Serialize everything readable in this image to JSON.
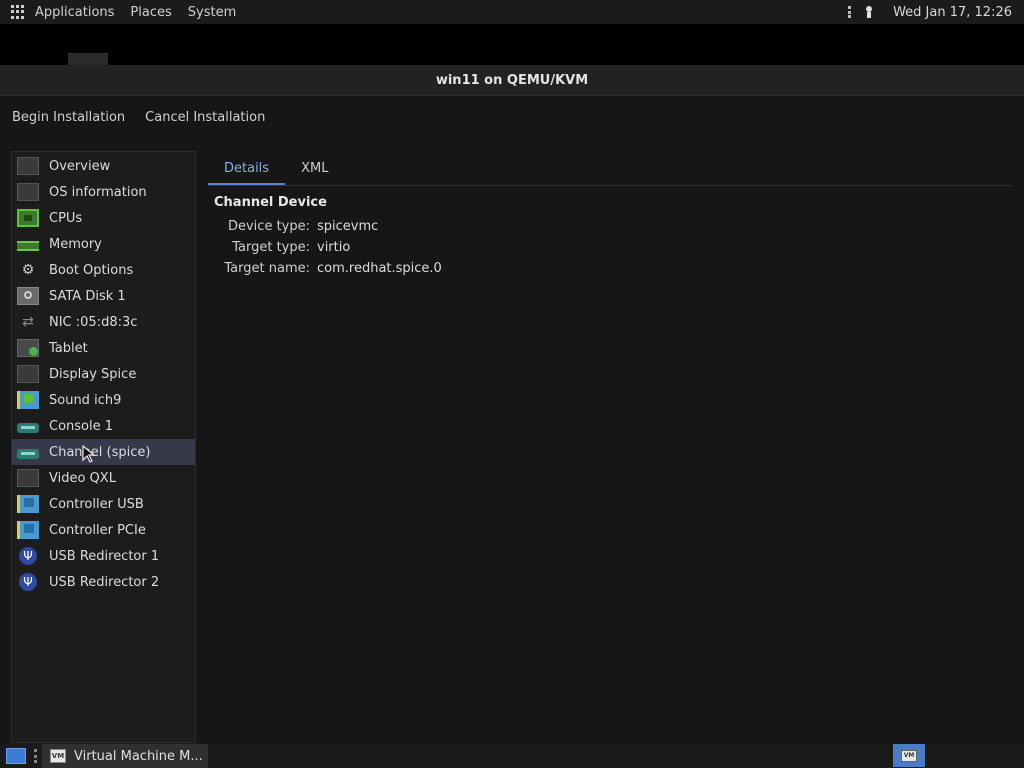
{
  "top_panel": {
    "menus": [
      "Applications",
      "Places",
      "System"
    ],
    "clock": "Wed Jan 17, 12:26"
  },
  "window": {
    "title": "win11 on QEMU/KVM",
    "toolbar": {
      "begin_label": "Begin Installation",
      "cancel_label": "Cancel Installation"
    },
    "sidebar": {
      "items": [
        {
          "label": "Overview",
          "icon": "monitor-icon"
        },
        {
          "label": "OS information",
          "icon": "monitor-icon"
        },
        {
          "label": "CPUs",
          "icon": "cpu-icon"
        },
        {
          "label": "Memory",
          "icon": "memory-icon"
        },
        {
          "label": "Boot Options",
          "icon": "gear-icon"
        },
        {
          "label": "SATA Disk 1",
          "icon": "disk-icon"
        },
        {
          "label": "NIC :05:d8:3c",
          "icon": "network-icon"
        },
        {
          "label": "Tablet",
          "icon": "tablet-icon"
        },
        {
          "label": "Display Spice",
          "icon": "monitor-icon"
        },
        {
          "label": "Sound ich9",
          "icon": "sound-card-icon"
        },
        {
          "label": "Console 1",
          "icon": "serial-icon"
        },
        {
          "label": "Channel (spice)",
          "icon": "serial-icon",
          "selected": true
        },
        {
          "label": "Video QXL",
          "icon": "monitor-icon"
        },
        {
          "label": "Controller USB",
          "icon": "controller-card-icon"
        },
        {
          "label": "Controller PCIe",
          "icon": "controller-card-icon"
        },
        {
          "label": "USB Redirector 1",
          "icon": "usb-icon"
        },
        {
          "label": "USB Redirector 2",
          "icon": "usb-icon"
        }
      ]
    },
    "tabs": [
      {
        "label": "Details",
        "active": true
      },
      {
        "label": "XML",
        "active": false
      }
    ],
    "details": {
      "section_title": "Channel Device",
      "props": [
        {
          "label": "Device type:",
          "value": "spicevmc"
        },
        {
          "label": "Target type:",
          "value": "virtio"
        },
        {
          "label": "Target name:",
          "value": "com.redhat.spice.0"
        }
      ]
    }
  },
  "bottom_panel": {
    "task_label": "Virtual Machine M...",
    "task_icon_text": "VM",
    "workspace_icon_text": "VM"
  },
  "colors": {
    "accent": "#5a7fcf",
    "selection": "#35394a"
  }
}
